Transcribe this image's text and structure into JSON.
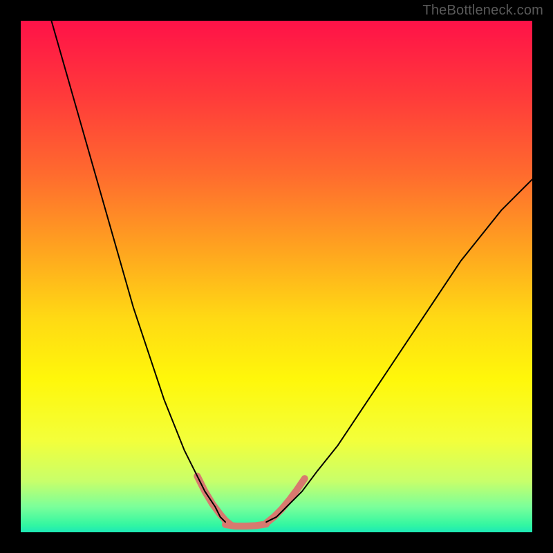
{
  "watermark": {
    "text": "TheBottleneck.com"
  },
  "chart_data": {
    "type": "line",
    "title": "",
    "xlabel": "",
    "ylabel": "",
    "xlim": [
      0,
      100
    ],
    "ylim": [
      0,
      100
    ],
    "grid": false,
    "legend": false,
    "gradient_background": {
      "type": "vertical",
      "stops": [
        {
          "pos": 0.0,
          "color": "#ff1248"
        },
        {
          "pos": 0.15,
          "color": "#ff3b3a"
        },
        {
          "pos": 0.3,
          "color": "#ff6b2e"
        },
        {
          "pos": 0.45,
          "color": "#ffa51f"
        },
        {
          "pos": 0.58,
          "color": "#ffd914"
        },
        {
          "pos": 0.7,
          "color": "#fff70a"
        },
        {
          "pos": 0.82,
          "color": "#f3ff3a"
        },
        {
          "pos": 0.9,
          "color": "#c8ff6a"
        },
        {
          "pos": 0.95,
          "color": "#7bff9a"
        },
        {
          "pos": 0.985,
          "color": "#34f7a1"
        },
        {
          "pos": 1.0,
          "color": "#1de9b6"
        }
      ]
    },
    "series": [
      {
        "name": "left-curve",
        "color": "#000000",
        "stroke_width": 2,
        "x": [
          6,
          8,
          10,
          12,
          14,
          16,
          18,
          20,
          22,
          24,
          26,
          28,
          30,
          32,
          34,
          36,
          38,
          39,
          40
        ],
        "y": [
          100,
          93,
          86,
          79,
          72,
          65,
          58,
          51,
          44,
          38,
          32,
          26,
          21,
          16,
          12,
          8,
          5,
          3,
          2
        ]
      },
      {
        "name": "right-curve",
        "color": "#000000",
        "stroke_width": 2,
        "x": [
          48,
          50,
          52,
          55,
          58,
          62,
          66,
          70,
          74,
          78,
          82,
          86,
          90,
          94,
          98,
          100
        ],
        "y": [
          2,
          3,
          5,
          8,
          12,
          17,
          23,
          29,
          35,
          41,
          47,
          53,
          58,
          63,
          67,
          69
        ]
      },
      {
        "name": "valley-highlight-left",
        "color": "#d8796f",
        "stroke_width": 10,
        "x": [
          34.5,
          36,
          37.5,
          39,
          40,
          41
        ],
        "y": [
          11,
          8,
          5.5,
          3.5,
          2.3,
          1.5
        ]
      },
      {
        "name": "valley-highlight-bottom",
        "color": "#d8796f",
        "stroke_width": 10,
        "x": [
          40,
          42,
          44,
          46,
          48
        ],
        "y": [
          1.5,
          1.2,
          1.2,
          1.3,
          1.6
        ]
      },
      {
        "name": "valley-highlight-right",
        "color": "#d8796f",
        "stroke_width": 10,
        "x": [
          48,
          49.5,
          51,
          52.5,
          54,
          55.5
        ],
        "y": [
          1.8,
          3,
          4.5,
          6.3,
          8.3,
          10.5
        ]
      }
    ],
    "annotations": []
  }
}
